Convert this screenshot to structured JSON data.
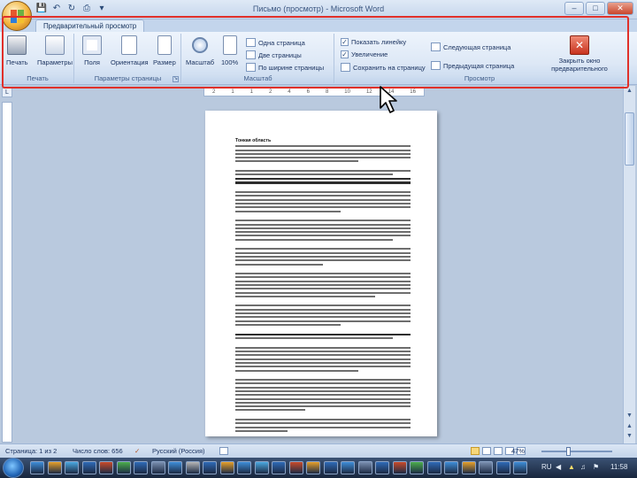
{
  "window": {
    "title": "Письмо (просмотр) - Microsoft Word"
  },
  "tabs": [
    {
      "label": "Предварительный просмотр",
      "active": true
    }
  ],
  "ribbon": {
    "groups": [
      {
        "label": "Печать",
        "buttons": [
          "Печать",
          "Параметры"
        ]
      },
      {
        "label": "Параметры страницы",
        "buttons": [
          "Поля",
          "Ориентация",
          "Размер"
        ]
      },
      {
        "label": "Масштаб",
        "buttons": [
          "Масштаб",
          "100%"
        ],
        "options": [
          "Одна страница",
          "Две страницы",
          "По ширине страницы"
        ]
      },
      {
        "label": "Просмотр",
        "checkboxes": [
          {
            "label": "Показать линейку",
            "checked": true
          },
          {
            "label": "Увеличение",
            "checked": true
          }
        ],
        "buttons": [
          "Сохранить на страницу",
          "Следующая страница",
          "Предыдущая страница",
          "Закрыть окно предварительного просмотра"
        ]
      }
    ]
  },
  "ruler": {
    "ticks": [
      "2",
      "1",
      "1",
      "2",
      "4",
      "6",
      "8",
      "10",
      "12",
      "14",
      "16"
    ]
  },
  "document": {
    "heading": "Тонкая область"
  },
  "statusbar": {
    "page": "Страница: 1 из 2",
    "words": "Число слов: 656",
    "language": "Русский (Россия)",
    "zoom": "47%"
  },
  "taskbar": {
    "lang": "RU",
    "clock": "11:58"
  },
  "colors": {
    "highlight": "#e0302a",
    "ribbon": "#dde8f6",
    "close": "#c9452c"
  }
}
